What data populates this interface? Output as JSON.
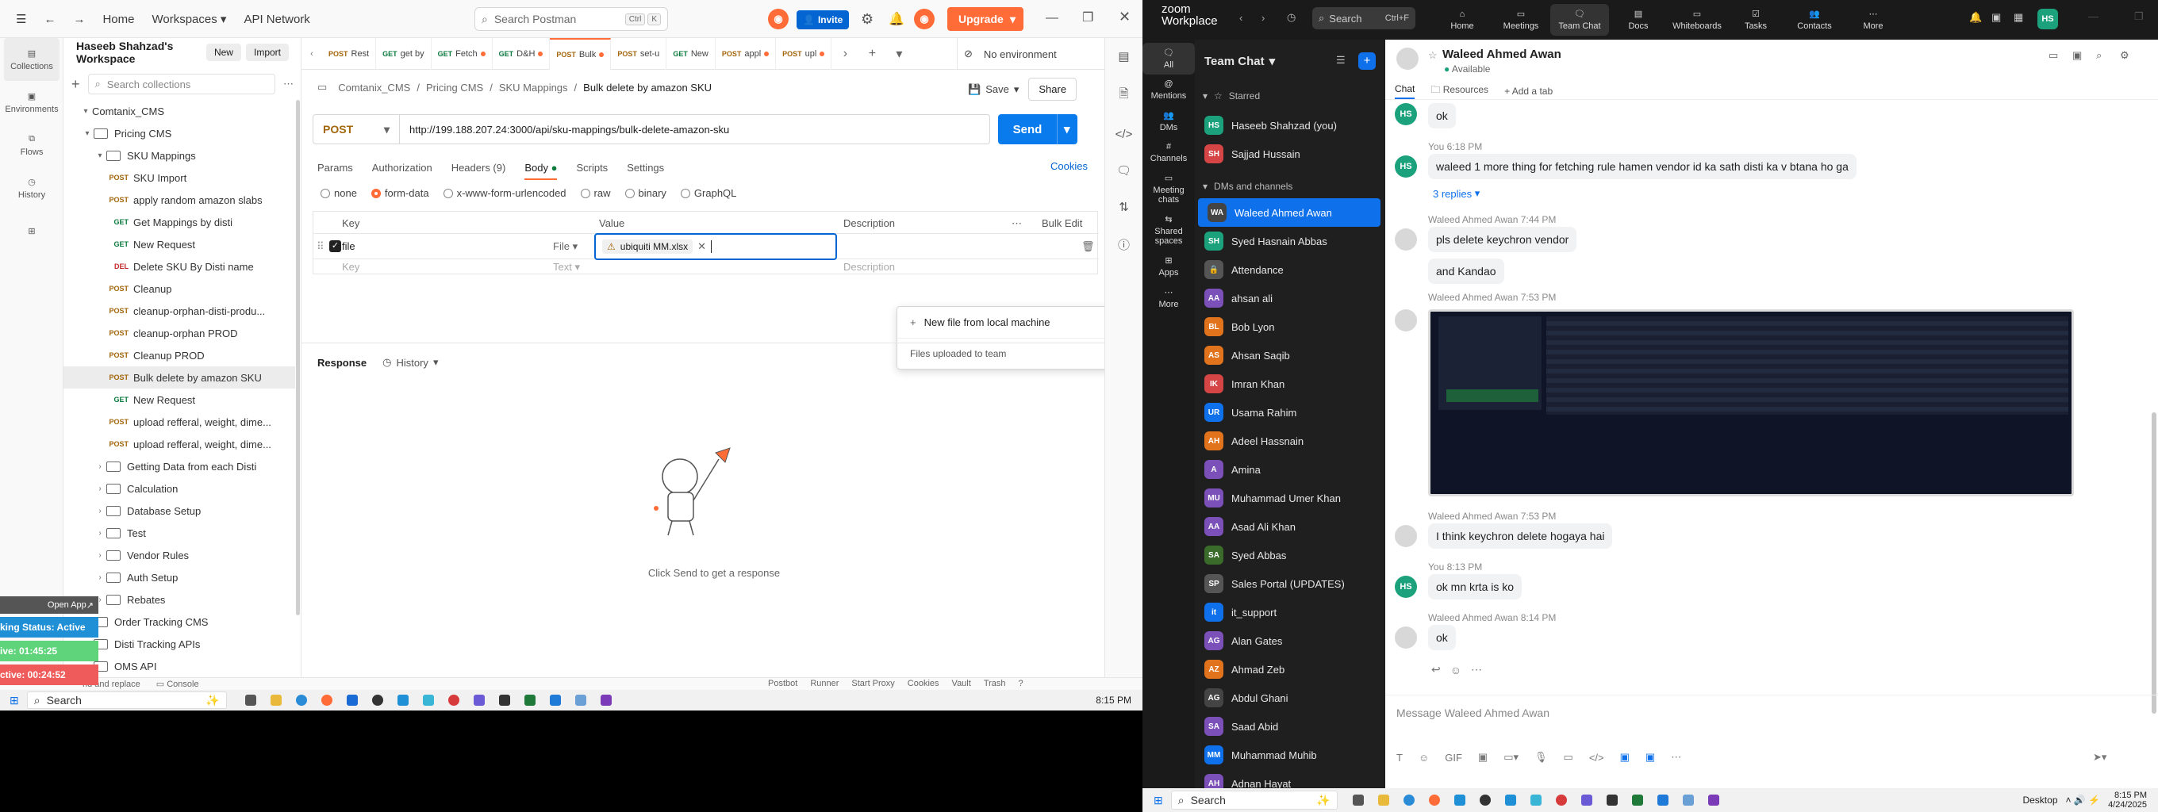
{
  "postman": {
    "topbar": {
      "home": "Home",
      "workspaces": "Workspaces",
      "api_network": "API Network",
      "search_placeholder": "Search Postman",
      "kbd1": "Ctrl",
      "kbd2": "K",
      "invite": "Invite",
      "upgrade": "Upgrade"
    },
    "rail": [
      "Collections",
      "Environments",
      "Flows",
      "History"
    ],
    "workspace": {
      "name": "Haseeb Shahzad's Workspace",
      "new": "New",
      "import": "Import",
      "search_placeholder": "Search collections"
    },
    "tree": [
      {
        "type": "root",
        "label": "Comtanix_CMS"
      },
      {
        "type": "folder",
        "label": "Pricing CMS"
      },
      {
        "type": "folder",
        "label": "SKU Mappings"
      },
      {
        "type": "req",
        "m": "POST",
        "label": "SKU Import"
      },
      {
        "type": "req",
        "m": "POST",
        "label": "apply random amazon slabs"
      },
      {
        "type": "req",
        "m": "GET",
        "label": "Get Mappings by disti"
      },
      {
        "type": "req",
        "m": "GET",
        "label": "New Request"
      },
      {
        "type": "req",
        "m": "DEL",
        "label": "Delete SKU By Disti name"
      },
      {
        "type": "req",
        "m": "POST",
        "label": "Cleanup"
      },
      {
        "type": "req",
        "m": "POST",
        "label": "cleanup-orphan-disti-produ..."
      },
      {
        "type": "req",
        "m": "POST",
        "label": "cleanup-orphan PROD"
      },
      {
        "type": "req",
        "m": "POST",
        "label": "Cleanup PROD"
      },
      {
        "type": "req",
        "m": "POST",
        "label": "Bulk delete by amazon SKU"
      },
      {
        "type": "req",
        "m": "GET",
        "label": "New Request"
      },
      {
        "type": "req",
        "m": "POST",
        "label": "upload refferal, weight, dime..."
      },
      {
        "type": "req",
        "m": "POST",
        "label": "upload refferal, weight, dime..."
      },
      {
        "type": "folder",
        "label": "Getting Data from each Disti"
      },
      {
        "type": "folder",
        "label": "Calculation"
      },
      {
        "type": "folder",
        "label": "Database Setup"
      },
      {
        "type": "folder",
        "label": "Test"
      },
      {
        "type": "folder",
        "label": "Vendor Rules"
      },
      {
        "type": "folder",
        "label": "Auth Setup"
      },
      {
        "type": "folder",
        "label": "Rebates"
      },
      {
        "type": "folder",
        "label": "Order Tracking CMS"
      },
      {
        "type": "folder",
        "label": "Disti Tracking APIs"
      },
      {
        "type": "folder",
        "label": "OMS API"
      }
    ],
    "tabs": [
      {
        "m": "POST",
        "label": "Rest"
      },
      {
        "m": "GET",
        "label": "get by"
      },
      {
        "m": "GET",
        "label": "Fetch"
      },
      {
        "m": "GET",
        "label": "D&H"
      },
      {
        "m": "POST",
        "label": "Bulk"
      },
      {
        "m": "POST",
        "label": "set-u"
      },
      {
        "m": "GET",
        "label": "New"
      },
      {
        "m": "POST",
        "label": "appl"
      },
      {
        "m": "POST",
        "label": "upl"
      }
    ],
    "environment": "No environment",
    "breadcrumb": [
      "Comtanix_CMS",
      "Pricing CMS",
      "SKU Mappings",
      "Bulk delete by amazon SKU"
    ],
    "save": "Save",
    "share": "Share",
    "method": "POST",
    "url": "http://199.188.207.24:3000/api/sku-mappings/bulk-delete-amazon-sku",
    "send": "Send",
    "req_tabs": [
      "Params",
      "Authorization",
      "Headers (9)",
      "Body",
      "Scripts",
      "Settings"
    ],
    "cookies": "Cookies",
    "body_types": [
      "none",
      "form-data",
      "x-www-form-urlencoded",
      "raw",
      "binary",
      "GraphQL"
    ],
    "kv": {
      "key_h": "Key",
      "value_h": "Value",
      "desc_h": "Description",
      "bulk": "Bulk Edit",
      "row_key": "file",
      "row_type": "File",
      "row_value": "ubiquiti MM.xlsx",
      "ph_key": "Key",
      "ph_type": "Text",
      "ph_desc": "Description"
    },
    "dropdown": {
      "new_file": "New file from local machine",
      "team": "Files uploaded to team"
    },
    "response": {
      "title": "Response",
      "history": "History",
      "hint": "Click Send to get a response"
    },
    "status": [
      "Postbot",
      "Runner",
      "Start Proxy",
      "Cookies",
      "Vault",
      "Trash"
    ],
    "status_left": [
      "nd and replace",
      "Console"
    ],
    "overlay": {
      "open_app": "Open App",
      "tracking": "king Status: Active",
      "active": "ive: 01:45:25",
      "inactive": "ctive: 00:24:52"
    }
  },
  "taskbar_left": {
    "search": "Search",
    "time": "8:15 PM"
  },
  "taskbar_right": {
    "search": "Search",
    "desktop": "Desktop",
    "time": "8:15 PM",
    "date": "4/24/2025"
  },
  "zoom": {
    "brand_top": "zoom",
    "brand_bottom": "Workplace",
    "search": "Search",
    "search_kbd": "Ctrl+F",
    "nav": [
      "Home",
      "Meetings",
      "Team Chat",
      "Docs",
      "Whiteboards",
      "Tasks",
      "Contacts",
      "More"
    ],
    "user_initials": "HS",
    "rail": [
      "All",
      "Mentions",
      "DMs",
      "Channels",
      "Meeting chats",
      "Shared spaces",
      "Apps",
      "More"
    ],
    "list_title": "Team Chat",
    "sections": {
      "starred": "Starred",
      "dms": "DMs and channels"
    },
    "starred": [
      {
        "i": "HS",
        "name": "Haseeb Shahzad (you)",
        "c": "#1ba17b"
      },
      {
        "i": "SH",
        "name": "Sajjad Hussain",
        "c": "#d64545"
      }
    ],
    "dms": [
      {
        "i": "WA",
        "name": "Waleed Ahmed Awan",
        "c": "#444"
      },
      {
        "i": "SH",
        "name": "Syed Hasnain Abbas",
        "c": "#1ba17b"
      },
      {
        "i": "🔒",
        "name": "Attendance",
        "c": "#555"
      },
      {
        "i": "AA",
        "name": "ahsan ali",
        "c": "#7b50b8"
      },
      {
        "i": "BL",
        "name": "Bob Lyon",
        "c": "#e0731c"
      },
      {
        "i": "AS",
        "name": "Ahsan Saqib",
        "c": "#e0731c"
      },
      {
        "i": "IK",
        "name": "Imran Khan",
        "c": "#d64545"
      },
      {
        "i": "UR",
        "name": "Usama Rahim",
        "c": "#0e71eb"
      },
      {
        "i": "AH",
        "name": "Adeel Hassnain",
        "c": "#e0731c"
      },
      {
        "i": "A",
        "name": "Amina",
        "c": "#7b50b8"
      },
      {
        "i": "MU",
        "name": "Muhammad Umer Khan",
        "c": "#7b50b8"
      },
      {
        "i": "AA",
        "name": "Asad Ali Khan",
        "c": "#7b50b8"
      },
      {
        "i": "SA",
        "name": "Syed Abbas",
        "c": "#3a6b2a"
      },
      {
        "i": "SP",
        "name": "Sales Portal (UPDATES)",
        "c": "#555"
      },
      {
        "i": "it",
        "name": "it_support",
        "c": "#0e71eb"
      },
      {
        "i": "AG",
        "name": "Alan Gates",
        "c": "#7b50b8"
      },
      {
        "i": "AZ",
        "name": "Ahmad Zeb",
        "c": "#e0731c"
      },
      {
        "i": "AG",
        "name": "Abdul Ghani",
        "c": "#444"
      },
      {
        "i": "SA",
        "name": "Saad Abid",
        "c": "#7b50b8"
      },
      {
        "i": "MM",
        "name": "Muhammad Muhib",
        "c": "#0e71eb"
      },
      {
        "i": "AH",
        "name": "Adnan Hayat",
        "c": "#7b50b8"
      }
    ],
    "chat": {
      "title": "Waleed Ahmed Awan",
      "status": "Available",
      "tabs": [
        "Chat",
        "Resources",
        "Add a tab"
      ],
      "m_ok": "ok",
      "m2_meta": "You 6:18 PM",
      "m2_text": "waleed 1 more thing for fetching rule hamen vendor id ka sath disti ka v btana ho ga",
      "replies": "3 replies",
      "m3_meta": "Waleed Ahmed Awan 7:44 PM",
      "m3_text": "pls delete keychron vendor",
      "m3b_text": "and Kandao",
      "m4_meta": "Waleed Ahmed Awan 7:53 PM",
      "m5_meta": "Waleed Ahmed Awan 7:53 PM",
      "m5_text": "I think keychron delete hogaya hai",
      "m6_meta": "You 8:13 PM",
      "m6_text": "ok mn krta is ko",
      "m7_meta": "Waleed Ahmed Awan 8:14 PM",
      "m7_text": "ok",
      "composer": "Message Waleed Ahmed Awan"
    }
  }
}
